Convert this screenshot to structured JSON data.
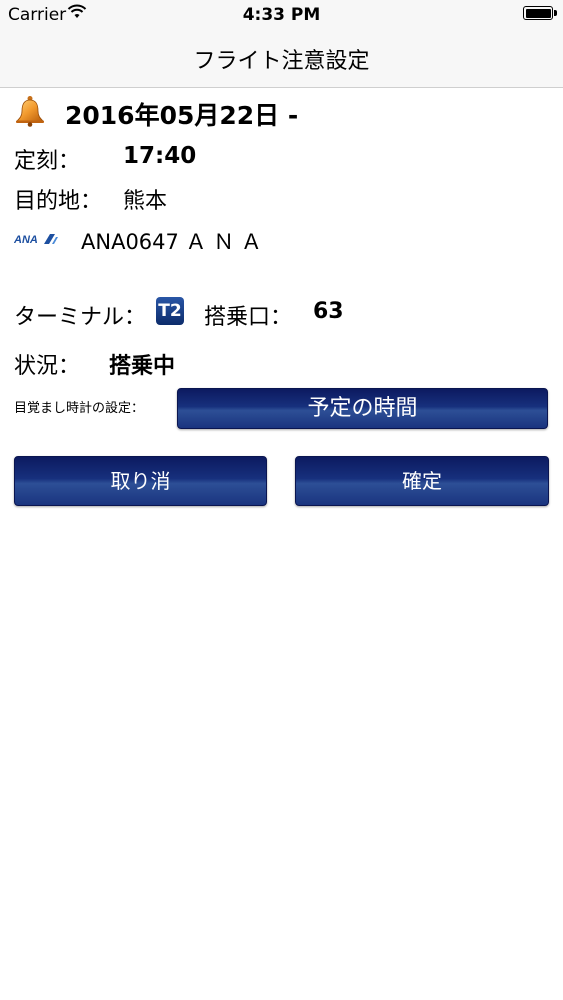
{
  "status_bar": {
    "carrier": "Carrier",
    "time": "4:33 PM"
  },
  "nav": {
    "title": "フライト注意設定"
  },
  "alert": {
    "date": "2016年05月22日 -"
  },
  "schedule": {
    "label": "定刻：",
    "value": "17:40"
  },
  "destination": {
    "label": "目的地：",
    "value": "熊本"
  },
  "flight": {
    "logo_text": "ANA",
    "number": "ANA0647 Ａ Ｎ Ａ"
  },
  "terminal": {
    "label": "ターミナル：",
    "icon_text": "T2",
    "gate_label": "搭乗口：",
    "gate_value": "63"
  },
  "status": {
    "label": "状況：",
    "value": "搭乗中"
  },
  "alarm": {
    "label": "目覚まし時計の設定：",
    "button": "予定の時間"
  },
  "actions": {
    "cancel": "取り消",
    "confirm": "確定"
  },
  "colors": {
    "button_top": "#0c1a60",
    "button_mid": "#2d4f96",
    "ana_blue": "#1d4fa0",
    "bell": "#e88a1a"
  }
}
